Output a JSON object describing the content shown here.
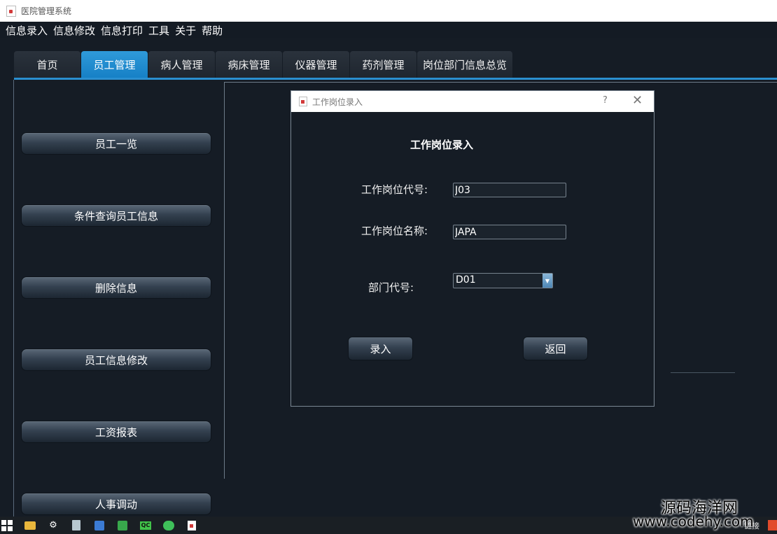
{
  "window": {
    "title": "医院管理系统"
  },
  "menu": [
    "信息录入",
    "信息修改",
    "信息打印",
    "工具",
    "关于",
    "帮助"
  ],
  "tabs": [
    {
      "label": "首页",
      "active": false
    },
    {
      "label": "员工管理",
      "active": true
    },
    {
      "label": "病人管理",
      "active": false
    },
    {
      "label": "病床管理",
      "active": false
    },
    {
      "label": "仪器管理",
      "active": false
    },
    {
      "label": "药剂管理",
      "active": false
    },
    {
      "label": "岗位部门信息总览",
      "active": false
    }
  ],
  "sidebar": [
    {
      "label": "员工一览"
    },
    {
      "label": "条件查询员工信息"
    },
    {
      "label": "删除信息"
    },
    {
      "label": "员工信息修改"
    },
    {
      "label": "工资报表"
    },
    {
      "label": "人事调动"
    }
  ],
  "dialog": {
    "title": "工作岗位录入",
    "help_glyph": "?",
    "close_glyph": "✕",
    "heading": "工作岗位录入",
    "fields": {
      "code_label": "工作岗位代号:",
      "code_value": "J03",
      "name_label": "工作岗位名称:",
      "name_value": "JAPA",
      "dept_label": "部门代号:",
      "dept_value": "D01"
    },
    "buttons": {
      "submit": "录入",
      "back": "返回"
    }
  },
  "watermark": {
    "line1": "源码海洋网",
    "line2": "www.codehy.com"
  },
  "taskbar": {
    "right_text": "链接"
  },
  "colors": {
    "tab_active": "#1680c6",
    "accent_line": "#2a8fd0",
    "background": "#141b24"
  }
}
